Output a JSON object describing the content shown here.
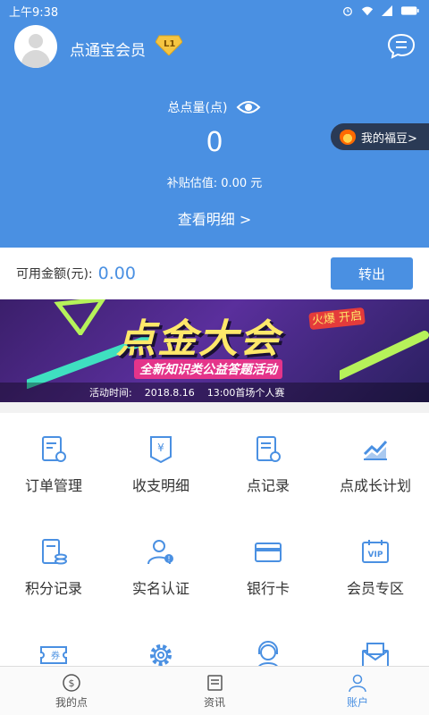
{
  "status_bar": {
    "time": "上午9:38"
  },
  "header": {
    "member_name": "点通宝会员",
    "level": "L1",
    "total_label": "总点量(点)",
    "total_value": "0",
    "subsidy": "补贴估值: 0.00  元",
    "detail_link": "查看明细  >",
    "fudou": "我的福豆>"
  },
  "balance": {
    "label": "可用金额(元):",
    "value": "0.00",
    "withdraw": "转出"
  },
  "banner": {
    "title": "点金大会",
    "subtitle": "全新知识类公益答题活动",
    "hot": "火爆 开启",
    "time_label": "活动时间:",
    "date": "2018.8.16",
    "time": "13:00首场个人赛"
  },
  "grid": [
    {
      "label": "订单管理",
      "icon": "order-manage-icon"
    },
    {
      "label": "收支明细",
      "icon": "income-expense-icon"
    },
    {
      "label": "点记录",
      "icon": "points-record-icon"
    },
    {
      "label": "点成长计划",
      "icon": "growth-plan-icon"
    },
    {
      "label": "积分记录",
      "icon": "score-record-icon"
    },
    {
      "label": "实名认证",
      "icon": "realname-icon"
    },
    {
      "label": "银行卡",
      "icon": "bank-card-icon"
    },
    {
      "label": "会员专区",
      "icon": "vip-zone-icon"
    },
    {
      "label": "",
      "icon": "coupon-icon"
    },
    {
      "label": "",
      "icon": "settings-icon"
    },
    {
      "label": "",
      "icon": "customer-service-icon"
    },
    {
      "label": "",
      "icon": "mail-icon"
    }
  ],
  "tabs": [
    {
      "label": "我的点",
      "icon": "dollar-icon",
      "active": false
    },
    {
      "label": "资讯",
      "icon": "news-icon",
      "active": false
    },
    {
      "label": "账户",
      "icon": "user-icon",
      "active": true
    }
  ],
  "colors": {
    "primary": "#4a90e2",
    "fudou_bg": "#2a3a55"
  }
}
